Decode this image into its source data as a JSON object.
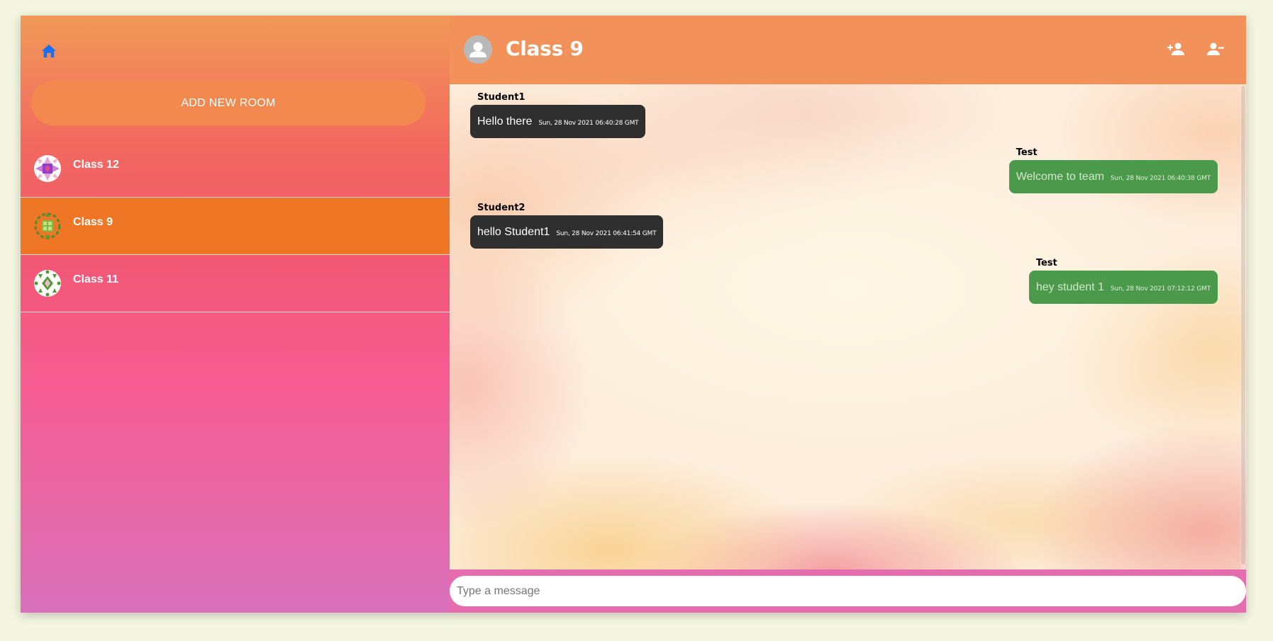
{
  "sidebar": {
    "home_icon": "home-icon",
    "add_room_label": "ADD NEW ROOM",
    "rooms": [
      {
        "name": "Class 12",
        "avatar": "pattern-avatar-purple",
        "active": false
      },
      {
        "name": "Class 9",
        "avatar": "pattern-avatar-green",
        "active": true
      },
      {
        "name": "Class 11",
        "avatar": "pattern-avatar-green-dots",
        "active": false
      }
    ]
  },
  "chat": {
    "title": "Class 9",
    "avatar_icon": "person-icon",
    "add_member_icon": "person-add-icon",
    "remove_member_icon": "person-remove-icon",
    "messages": [
      {
        "author": "Student1",
        "text": "Hello there",
        "time": "Sun, 28 Nov 2021 06:40:28 GMT",
        "side": "received"
      },
      {
        "author": "Test",
        "text": "Welcome to team",
        "time": "Sun, 28 Nov 2021 06:40:38 GMT",
        "side": "sent"
      },
      {
        "author": "Student2",
        "text": "hello Student1",
        "time": "Sun, 28 Nov 2021 06:41:54 GMT",
        "side": "received"
      },
      {
        "author": "Test",
        "text": "hey student 1",
        "time": "Sun, 28 Nov 2021 07:12:12 GMT",
        "side": "sent"
      }
    ]
  },
  "composer": {
    "placeholder": "Type a message",
    "value": ""
  },
  "colors": {
    "active_room": "#ee7624",
    "header": "#f2925a",
    "sent_bubble": "#4b9a4b",
    "received_bubble": "#2f2f2f",
    "home_icon": "#1a6ef2"
  }
}
